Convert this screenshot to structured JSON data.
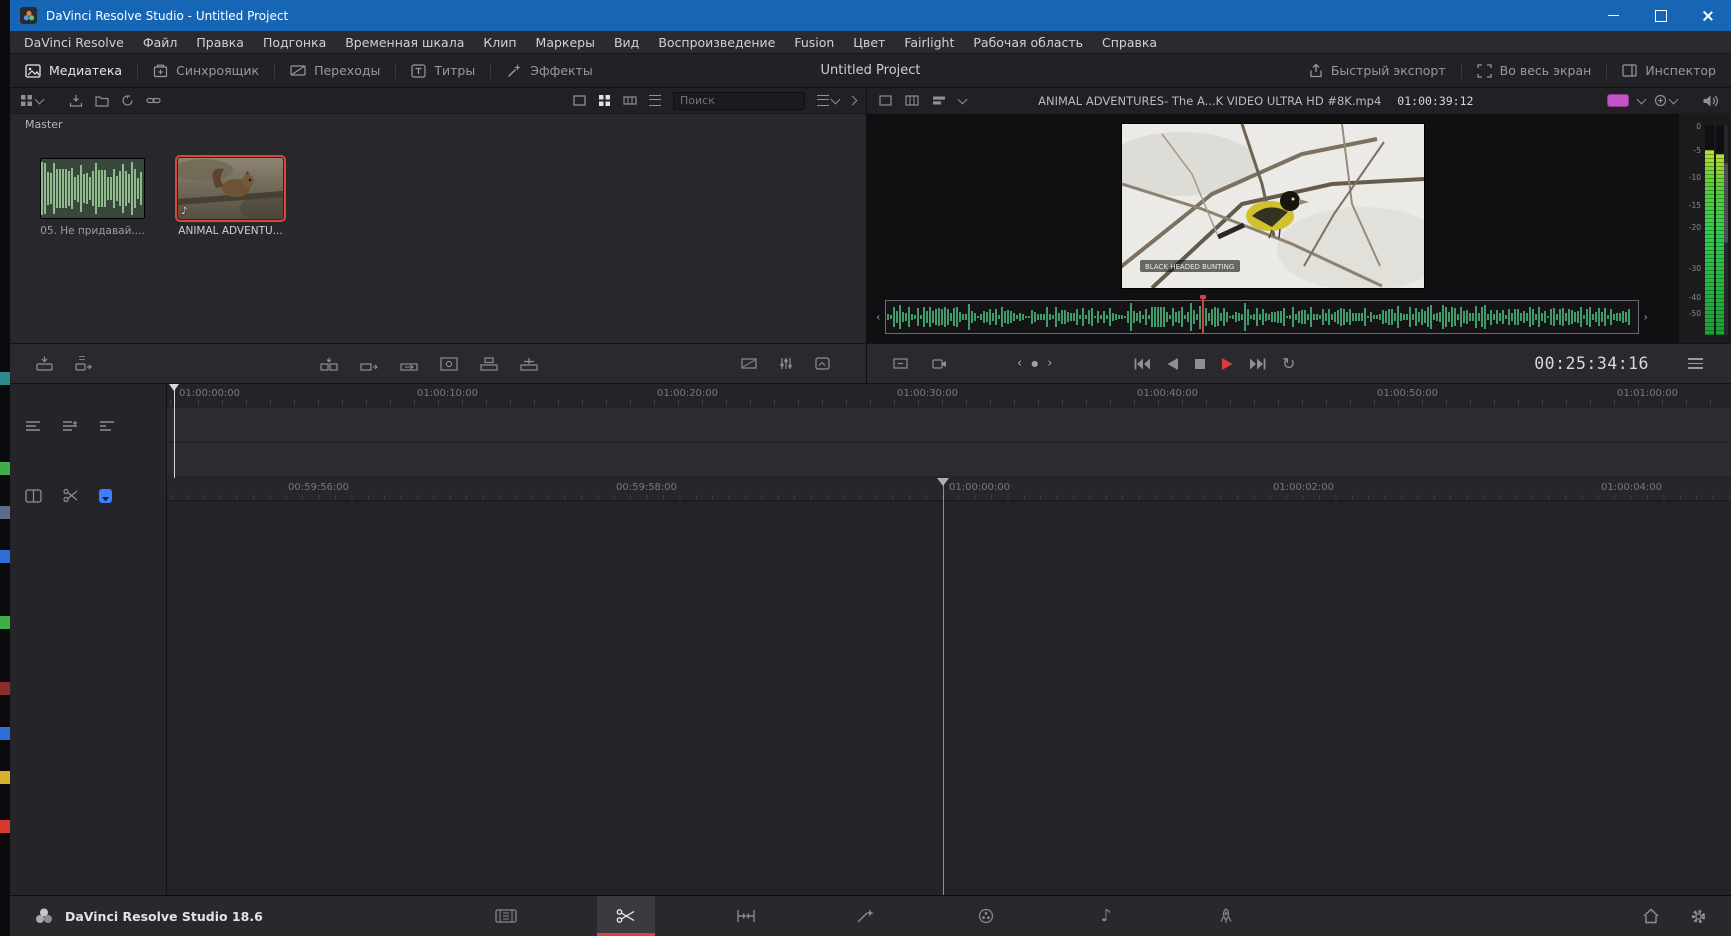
{
  "window": {
    "title": "DaVinci Resolve Studio - Untitled Project"
  },
  "menu": {
    "items": [
      "DaVinci Resolve",
      "Файл",
      "Правка",
      "Подгонка",
      "Временная шкала",
      "Клип",
      "Маркеры",
      "Вид",
      "Воспроизведение",
      "Fusion",
      "Цвет",
      "Fairlight",
      "Рабочая область",
      "Справка"
    ]
  },
  "toolbar": {
    "media_pool": "Медиатека",
    "sync_bin": "Синхроящик",
    "transitions": "Переходы",
    "titles": "Титры",
    "effects": "Эффекты",
    "project_title": "Untitled Project",
    "quick_export": "Быстрый экспорт",
    "fullscreen": "Во весь экран",
    "inspector": "Инспектор"
  },
  "media_pool": {
    "bin": "Master",
    "search_placeholder": "Поиск",
    "clips": [
      {
        "name": "05. Не придавай....",
        "type": "audio"
      },
      {
        "name": "ANIMAL ADVENTU...",
        "type": "video",
        "selected": true
      }
    ]
  },
  "viewer": {
    "clip_name": "ANIMAL ADVENTURES- The A...K VIDEO ULTRA HD #8K.mp4",
    "clip_timecode": "01:00:39:12",
    "caption": "BLACK HEADED BUNTING",
    "timecode": "00:25:34:16"
  },
  "meters": {
    "labels": [
      "0",
      "-5",
      "-10",
      "-15",
      "-20",
      "-30",
      "-40",
      "-50"
    ]
  },
  "timeline_upper": {
    "ticks": [
      "01:00:00:00",
      "01:00:10:00",
      "01:00:20:00",
      "01:00:30:00",
      "01:00:40:00",
      "01:00:50:00",
      "01:01:00:00"
    ]
  },
  "timeline_lower": {
    "ticks": [
      "00:59:56:00",
      "00:59:58:00",
      "01:00:00:00",
      "01:00:02:00",
      "01:00:04:00"
    ]
  },
  "statusbar": {
    "version": "DaVinci Resolve Studio 18.6",
    "pages": [
      "media",
      "cut",
      "edit",
      "fusion",
      "color",
      "fairlight",
      "deliver"
    ],
    "active_page": "cut"
  },
  "icons": {
    "loop": "↻",
    "prev": "‹",
    "next": "›",
    "dot": "●",
    "note": "♪",
    "titles_glyph": "T"
  },
  "colors": {
    "titlebar_blue": "#1765b5",
    "selection_red": "#d9473a",
    "page_accent_red": "#d84242",
    "waveform_green": "#3f9b68",
    "meter_green": "#2bd14a",
    "marker_blue": "#3d7eff",
    "playhead_red": "#d84040"
  }
}
